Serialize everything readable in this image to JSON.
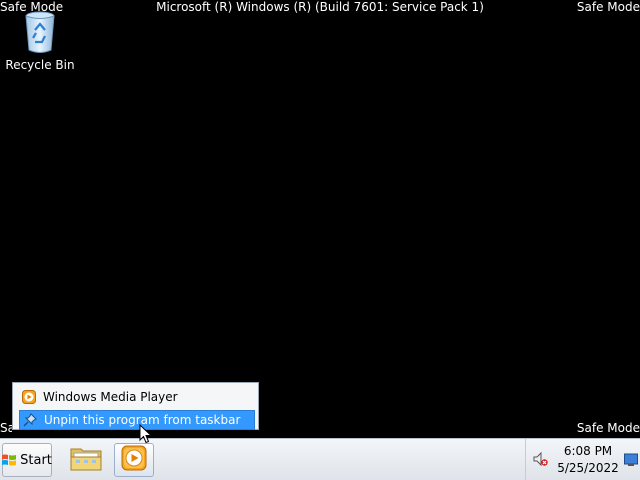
{
  "desktop": {
    "safe_mode_label": "Safe Mode",
    "safe_mode_label_partial": "Saf",
    "build_string": "Microsoft (R) Windows (R) (Build 7601: Service Pack 1)",
    "background_color": "#000000",
    "icons": [
      {
        "label": "Recycle Bin",
        "icon": "recycle-bin-icon"
      }
    ]
  },
  "jump_list": {
    "items": [
      {
        "label": "Windows Media Player",
        "icon": "windows-media-player-icon"
      },
      {
        "label": "Unpin this program from taskbar",
        "icon": "unpin-icon",
        "highlighted": true
      }
    ],
    "highlight_color": "#3399ff"
  },
  "taskbar": {
    "start_label": "Start",
    "pinned": [
      {
        "name": "Windows Explorer",
        "icon": "folder-icon"
      },
      {
        "name": "Windows Media Player",
        "icon": "windows-media-player-icon",
        "active": true
      }
    ],
    "tray": {
      "time": "6:08 PM",
      "date": "5/25/2022",
      "volume_icon": "speaker-muted-icon",
      "show_desktop_icon": "show-desktop-icon"
    }
  }
}
